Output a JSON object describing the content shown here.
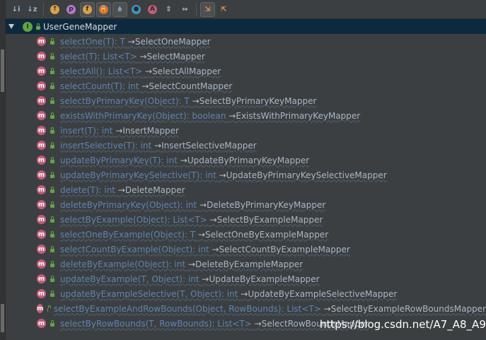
{
  "toolbar": {
    "buttons": [
      {
        "name": "sort-visibility-icon",
        "glyph": "↓i"
      },
      {
        "name": "sort-alpha-icon",
        "glyph": "↓z"
      },
      {
        "name": "show-inherited-icon",
        "glyph": "↑"
      },
      {
        "name": "show-properties-icon",
        "glyph": "p"
      },
      {
        "name": "show-fields-icon",
        "glyph": "f"
      },
      {
        "name": "show-non-public-icon",
        "glyph": "🔒"
      },
      {
        "name": "show-lambdas-icon",
        "glyph": "⋔"
      },
      {
        "name": "show-anonymous-icon",
        "glyph": "●"
      },
      {
        "name": "show-abstract-icon",
        "glyph": "A"
      },
      {
        "name": "expand-all-icon",
        "glyph": "⇕"
      },
      {
        "name": "collapse-all-icon",
        "glyph": "⇔"
      },
      {
        "name": "autoscroll-to-source-icon",
        "glyph": "⇲"
      },
      {
        "name": "autoscroll-from-source-icon",
        "glyph": "⇱"
      }
    ]
  },
  "tree": {
    "root": {
      "label": "UserGeneMapper",
      "icon": "interface-icon"
    },
    "methods": [
      {
        "sig": "selectOne(T): T",
        "impl": "SelectOneMapper"
      },
      {
        "sig": "select(T): List<T>",
        "impl": "SelectMapper"
      },
      {
        "sig": "selectAll(): List<T>",
        "impl": "SelectAllMapper"
      },
      {
        "sig": "selectCount(T): int",
        "impl": "SelectCountMapper"
      },
      {
        "sig": "selectByPrimaryKey(Object): T",
        "impl": "SelectByPrimaryKeyMapper"
      },
      {
        "sig": "existsWithPrimaryKey(Object): boolean",
        "impl": "ExistsWithPrimaryKeyMapper"
      },
      {
        "sig": "insert(T): int",
        "impl": "InsertMapper"
      },
      {
        "sig": "insertSelective(T): int",
        "impl": "InsertSelectiveMapper"
      },
      {
        "sig": "updateByPrimaryKey(T): int",
        "impl": "UpdateByPrimaryKeyMapper"
      },
      {
        "sig": "updateByPrimaryKeySelective(T): int",
        "impl": "UpdateByPrimaryKeySelectiveMapper"
      },
      {
        "sig": "delete(T): int",
        "impl": "DeleteMapper"
      },
      {
        "sig": "deleteByPrimaryKey(Object): int",
        "impl": "DeleteByPrimaryKeyMapper"
      },
      {
        "sig": "selectByExample(Object): List<T>",
        "impl": "SelectByExampleMapper"
      },
      {
        "sig": "selectOneByExample(Object): T",
        "impl": "SelectOneByExampleMapper"
      },
      {
        "sig": "selectCountByExample(Object): int",
        "impl": "SelectCountByExampleMapper"
      },
      {
        "sig": "deleteByExample(Object): int",
        "impl": "DeleteByExampleMapper"
      },
      {
        "sig": "updateByExample(T, Object): int",
        "impl": "UpdateByExampleMapper"
      },
      {
        "sig": "updateByExampleSelective(T, Object): int",
        "impl": "UpdateByExampleSelectiveMapper"
      },
      {
        "sig": "selectByExampleAndRowBounds(Object, RowBounds): List<T>",
        "impl": "SelectByExampleRowBoundsMapper"
      },
      {
        "sig": "selectByRowBounds(T, RowBounds): List<T>",
        "impl": "SelectRowBoundsMapper"
      }
    ],
    "arrow": "→"
  },
  "watermark": "https://blog.csdn.net/A7_A8_A9",
  "colors": {
    "background": "#3c3f41",
    "selected_row": "#0d293e",
    "method_icon": "#c35c7a",
    "interface_icon": "#62a444",
    "method_text": "#5d84b3"
  }
}
